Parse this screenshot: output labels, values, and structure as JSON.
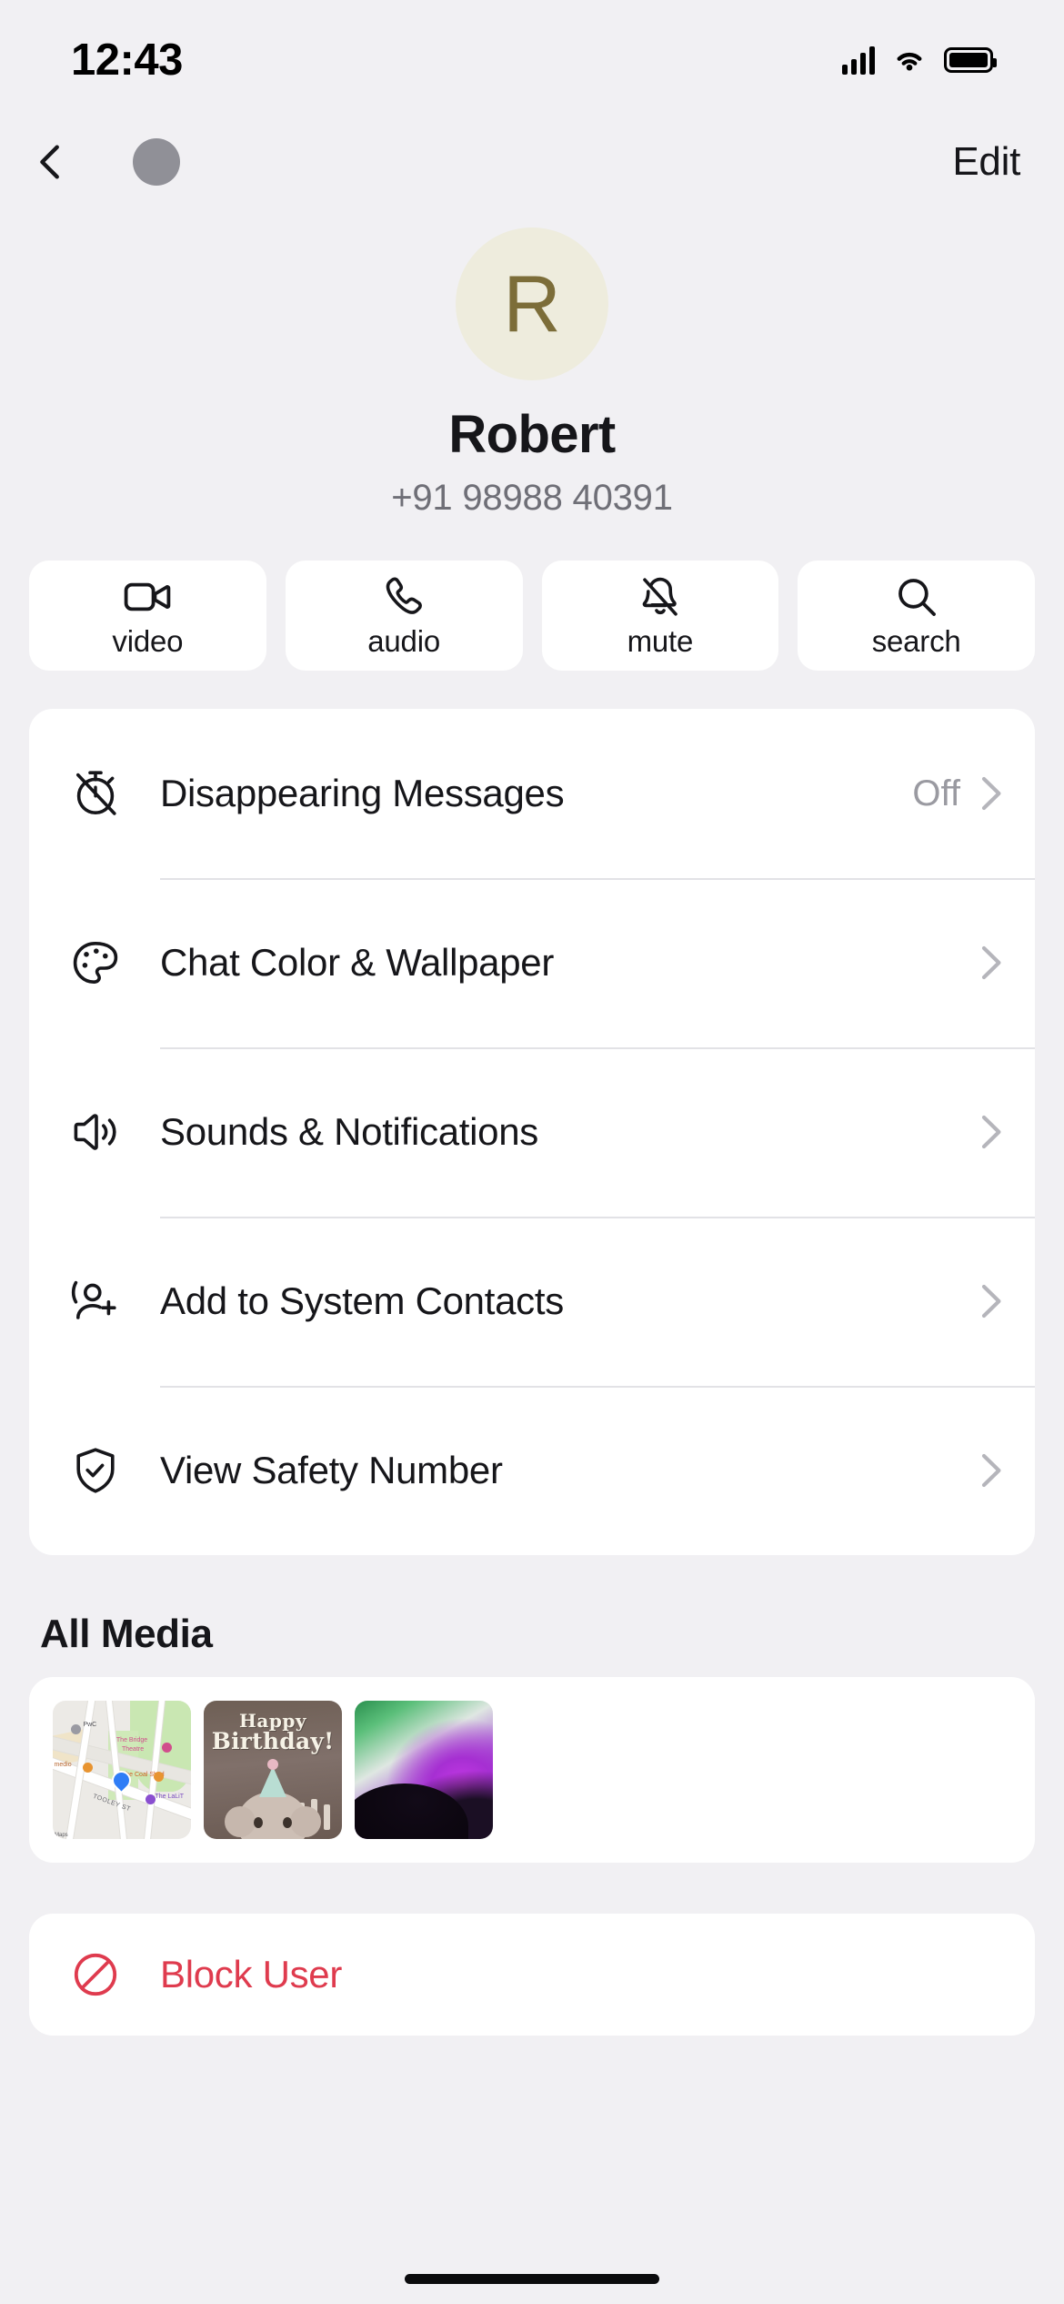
{
  "status_bar": {
    "time": "12:43",
    "signal_icon": "cellular-signal-icon",
    "wifi_icon": "wifi-icon",
    "battery_icon": "battery-full-icon"
  },
  "nav": {
    "back_icon": "chevron-left-icon",
    "mini_avatar": "contact-avatar-small",
    "edit_label": "Edit"
  },
  "profile": {
    "avatar_initial": "R",
    "avatar_bg": "#eeecdd",
    "avatar_fg": "#7c6d39",
    "name": "Robert",
    "phone": "+91 98988 40391"
  },
  "actions": [
    {
      "icon": "video-camera-icon",
      "label": "video"
    },
    {
      "icon": "phone-icon",
      "label": "audio"
    },
    {
      "icon": "bell-slash-icon",
      "label": "mute"
    },
    {
      "icon": "search-icon",
      "label": "search"
    }
  ],
  "settings": [
    {
      "icon": "timer-off-icon",
      "label": "Disappearing Messages",
      "value": "Off",
      "chevron": "chevron-right-icon"
    },
    {
      "icon": "palette-icon",
      "label": "Chat Color & Wallpaper",
      "value": "",
      "chevron": "chevron-right-icon"
    },
    {
      "icon": "speaker-wave-icon",
      "label": "Sounds & Notifications",
      "value": "",
      "chevron": "chevron-right-icon"
    },
    {
      "icon": "person-add-icon",
      "label": "Add to System Contacts",
      "value": "",
      "chevron": "chevron-right-icon"
    },
    {
      "icon": "shield-check-icon",
      "label": "View Safety Number",
      "value": "",
      "chevron": "chevron-right-icon"
    }
  ],
  "media": {
    "title": "All Media",
    "items": [
      {
        "type": "map-thumbnail",
        "labels": {
          "poi1": "PwC",
          "poi2": "The Bridge",
          "poi2b": "Theatre",
          "poi3": "The Coal Shed",
          "poi4": "The LaLiT",
          "poi5": "medio",
          "street": "TOOLEY ST",
          "attribution": "Maps"
        }
      },
      {
        "type": "birthday-photo-thumbnail",
        "line1": "Happy",
        "line2": "Birthday!"
      },
      {
        "type": "abstract-wallpaper-thumbnail"
      }
    ]
  },
  "block": {
    "icon": "block-circle-slash-icon",
    "label": "Block User",
    "color": "#df3b4e"
  },
  "colors": {
    "page_bg": "#f1f0f3",
    "card_bg": "#ffffff",
    "primary_text": "#16161a",
    "secondary_text": "#6f6f77",
    "divider": "#e2e2e6",
    "chevron": "#b5b5bb",
    "destructive": "#df3b4e"
  }
}
